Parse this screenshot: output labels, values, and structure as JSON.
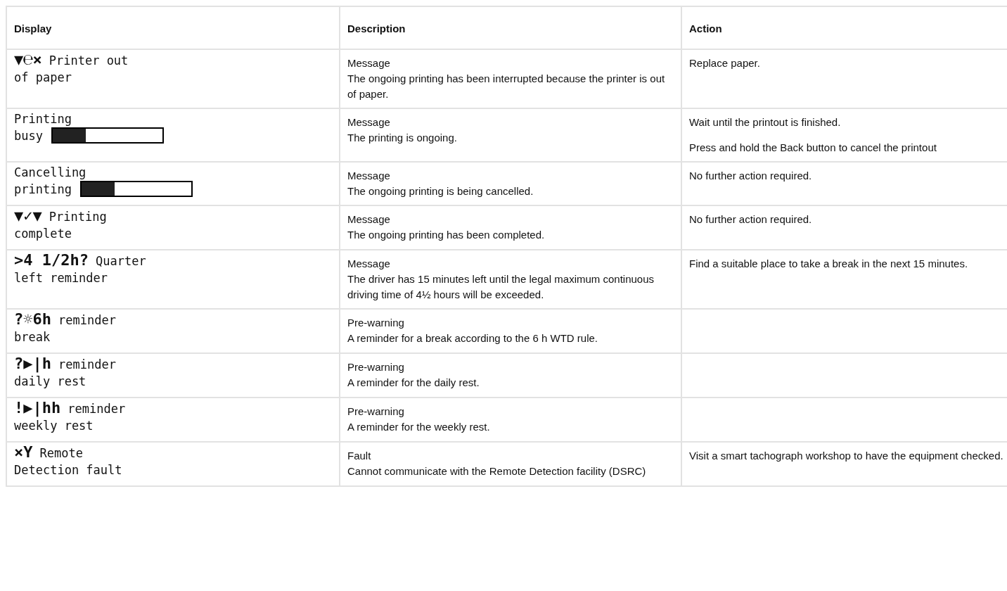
{
  "table": {
    "columns": [
      "Display",
      "Description",
      "Action"
    ],
    "rows": [
      {
        "display": {
          "symbols": "▼℮×",
          "line1": "Printer out",
          "line2": "of paper"
        },
        "description": {
          "type": "Message",
          "text": "The ongoing printing has been interrupted because the printer is out of paper."
        },
        "action": [
          "Replace paper."
        ]
      },
      {
        "display": {
          "line1": "Printing",
          "line2": "busy",
          "level": 0.3
        },
        "description": {
          "type": "Message",
          "text": "The printing is ongoing."
        },
        "action": [
          "Wait until the printout is finished.",
          "Press and hold the Back button to cancel the printout"
        ]
      },
      {
        "display": {
          "line1": "Cancelling",
          "line2": "printing",
          "level": 0.3
        },
        "description": {
          "type": "Message",
          "text": "The ongoing printing is being cancelled."
        },
        "action": [
          "No further action required."
        ]
      },
      {
        "display": {
          "symbols": "▼✓▼",
          "line1": "Printing",
          "line2": "complete"
        },
        "description": {
          "type": "Message",
          "text": "The ongoing printing has been completed."
        },
        "action": [
          "No further action required."
        ]
      },
      {
        "display": {
          "symbols": ">4 1/2h?",
          "line1": "Quarter",
          "line2": "left reminder"
        },
        "description": {
          "type": "Message",
          "text": "The driver has 15 minutes left until the legal maximum continuous driving time of 4½ hours will be exceeded."
        },
        "action": [
          "Find a suitable place to take a break in the next 15 minutes."
        ]
      },
      {
        "display": {
          "symbols": "?☼6h",
          "line1": "reminder",
          "line2": "break"
        },
        "description": {
          "type": "Pre-warning",
          "text": "A reminder for a break according to the 6 h WTD rule."
        },
        "action": []
      },
      {
        "display": {
          "symbols": "?▶|h",
          "line1": "reminder",
          "line2": "daily rest"
        },
        "description": {
          "type": "Pre-warning",
          "text": "A reminder for the daily rest."
        },
        "action": []
      },
      {
        "display": {
          "symbols": "!▶|hh",
          "line1": "reminder",
          "line2": "weekly rest"
        },
        "description": {
          "type": "Pre-warning",
          "text": "A reminder for the weekly rest."
        },
        "action": []
      },
      {
        "display": {
          "symbols": "×Y",
          "line1": "Remote",
          "line2": "Detection fault"
        },
        "description": {
          "type": "Fault",
          "text": "Cannot communicate with the Remote Detection facility (DSRC)"
        },
        "action": [
          "Visit a smart tachograph workshop to have the equipment checked."
        ]
      }
    ]
  }
}
